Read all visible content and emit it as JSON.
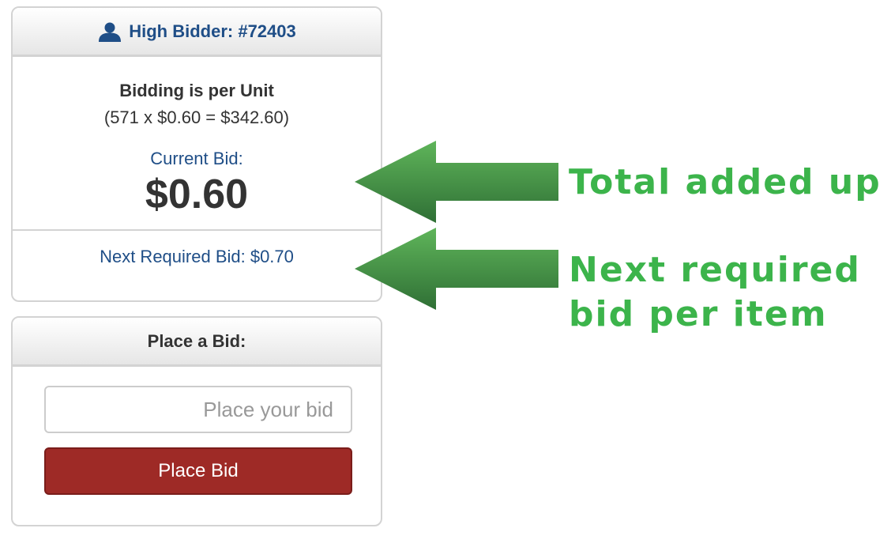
{
  "bid_info": {
    "high_bidder_text": "High Bidder: #72403",
    "bidding_per_unit": "Bidding is per Unit",
    "bidding_calculation": "(571 x $0.60 = $342.60)",
    "current_bid_label": "Current Bid:",
    "current_bid_value": "$0.60",
    "next_required_bid": "Next Required Bid: $0.70"
  },
  "place_bid": {
    "heading": "Place a Bid:",
    "input_placeholder": "Place your bid",
    "input_value": "",
    "button_label": "Place Bid"
  },
  "annotations": {
    "total_note": "Total added up",
    "next_note_line1": "Next required",
    "next_note_line2": "bid per item"
  },
  "icons": {
    "high_bidder": "user-icon",
    "arrows": "left-arrow-icon"
  },
  "colors": {
    "link_blue": "#1f4e87",
    "button_red": "#9e2a26",
    "annotation_green": "#3cb44b",
    "arrow_green_light": "#5fb55a",
    "arrow_green_dark": "#2f6f35"
  }
}
